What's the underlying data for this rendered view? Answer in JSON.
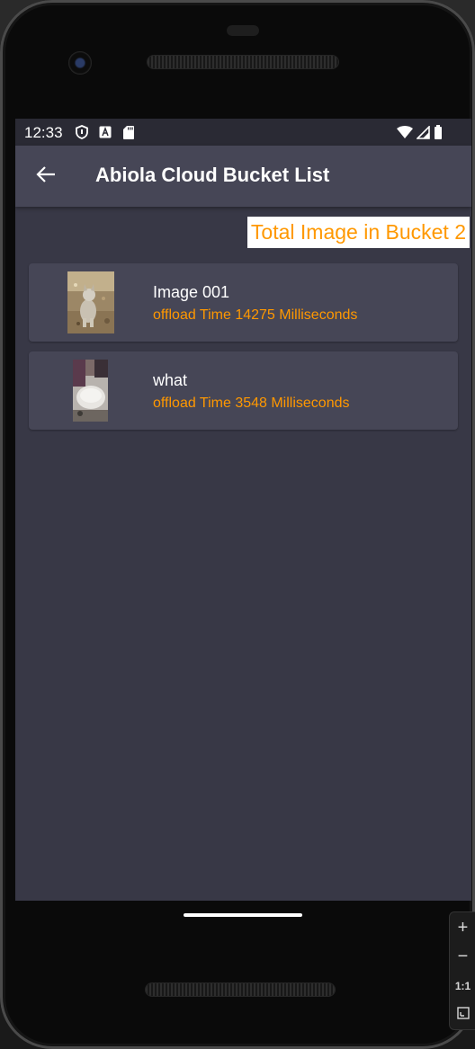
{
  "status_bar": {
    "time": "12:33"
  },
  "app_bar": {
    "title": "Abiola Cloud Bucket List",
    "back_icon": "arrow-back-icon"
  },
  "summary": {
    "total_label": "Total Image in Bucket 2"
  },
  "images": [
    {
      "title": "Image 001",
      "subtitle": "offload Time 14275 Milliseconds"
    },
    {
      "title": "what",
      "subtitle": "offload Time 3548 Milliseconds"
    }
  ],
  "emulator_controls": {
    "zoom_in": "+",
    "zoom_out": "−",
    "actual_size": "1:1"
  },
  "colors": {
    "accent": "#ff9800",
    "app_bar": "#464656",
    "background": "#383846",
    "card": "#464656"
  }
}
